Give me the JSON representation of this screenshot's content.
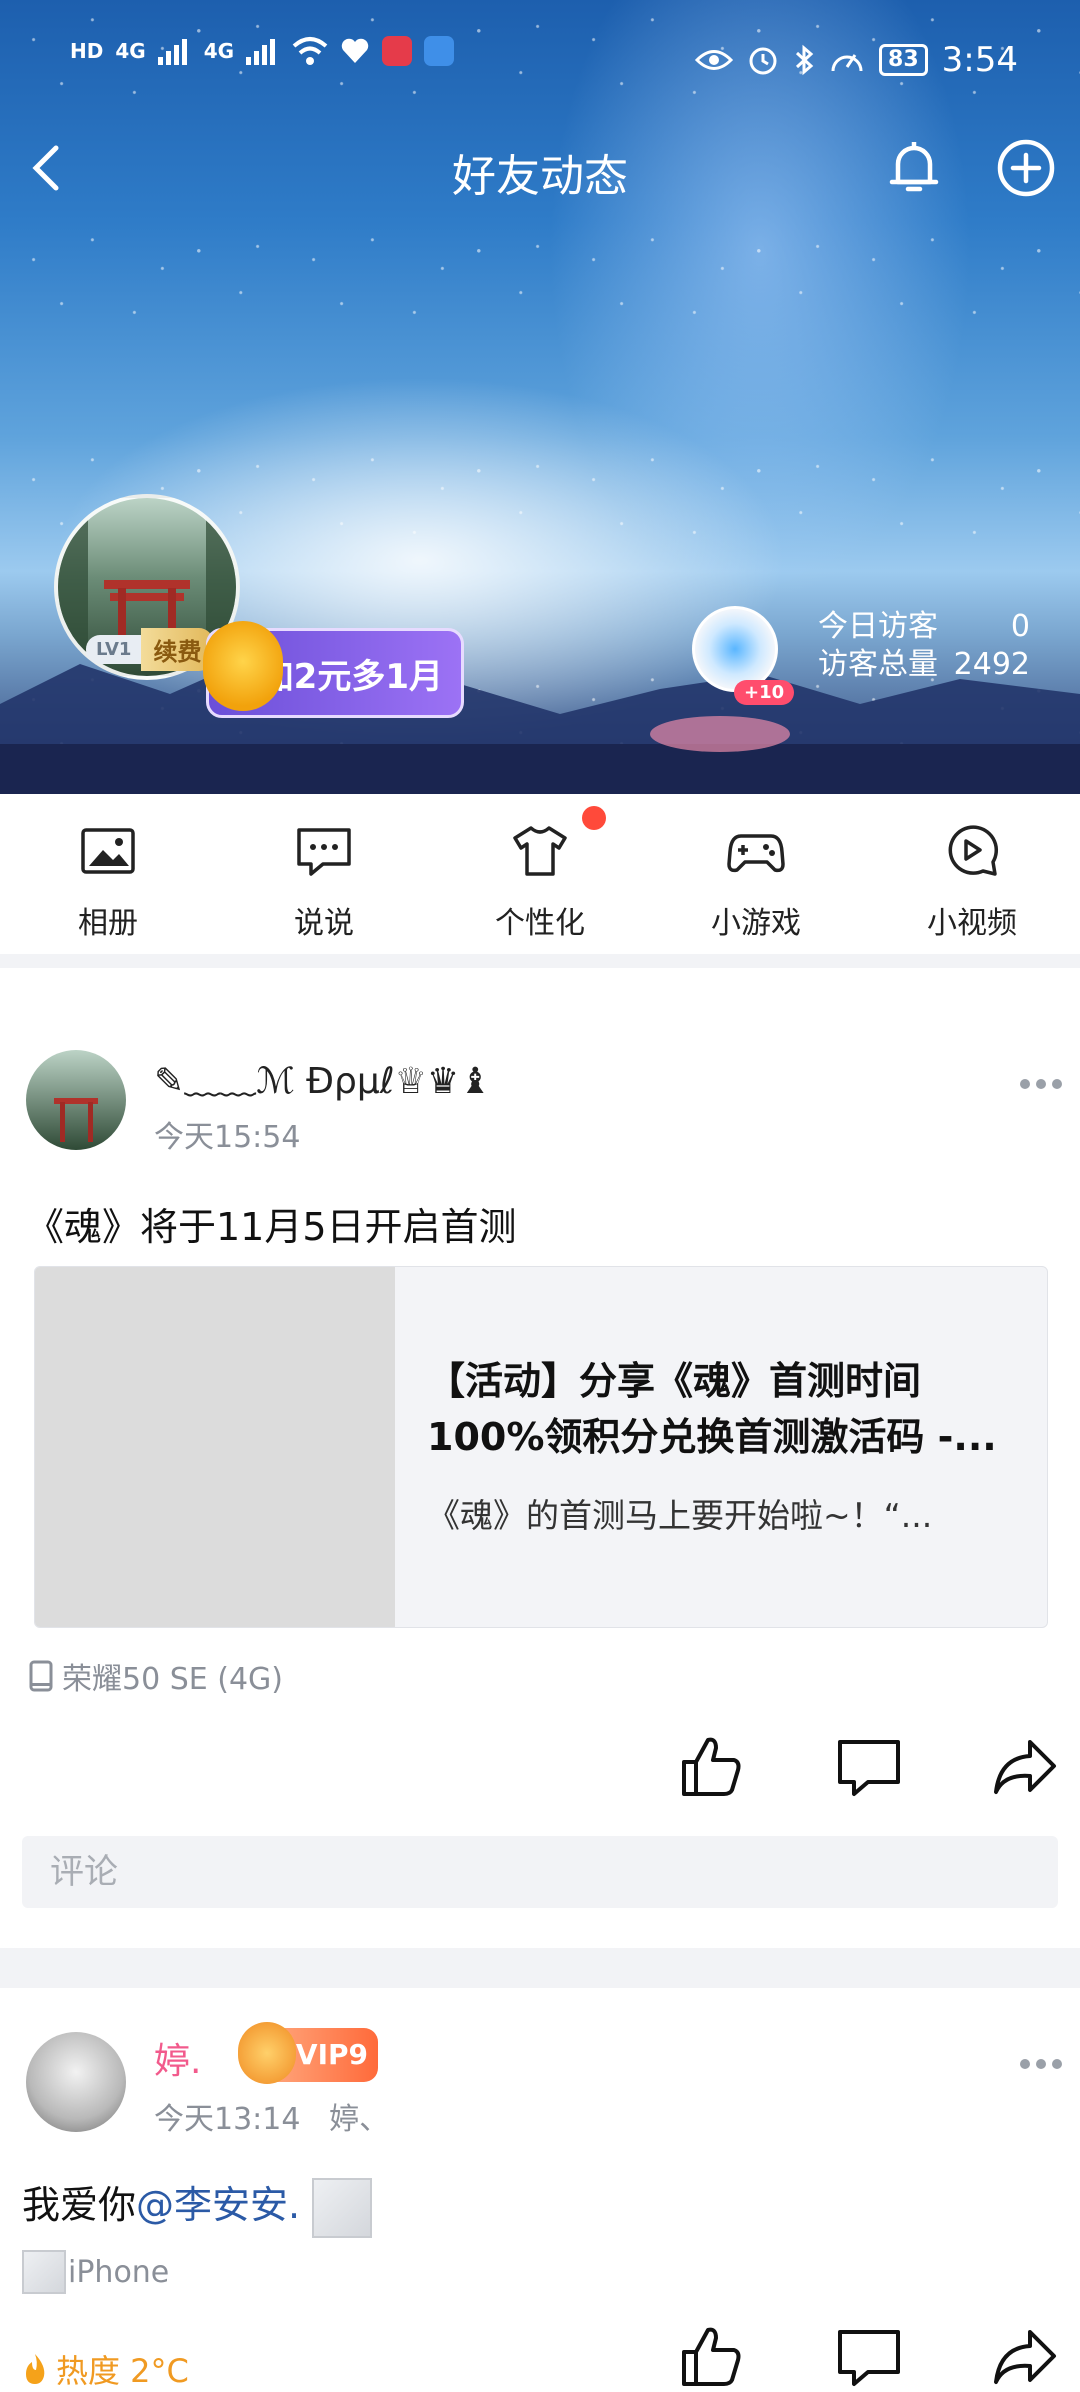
{
  "status_bar": {
    "left_labels": [
      "HD",
      "4G",
      "4G"
    ],
    "time": "3:54",
    "battery": "83",
    "icons": [
      "signal-icon",
      "wifi-icon",
      "health-icon",
      "book-app-icon",
      "browser-app-icon",
      "eye-icon",
      "alarm-icon",
      "bluetooth-icon",
      "speed-icon"
    ]
  },
  "header": {
    "title": "好友动态",
    "back_icon": "chevron-left-icon",
    "bell_icon": "bell-icon",
    "add_icon": "plus-circle-icon"
  },
  "profile": {
    "level": "LV1",
    "renew_label": "续费",
    "promo_label": "加2元多1月",
    "visitor_badge": "+10",
    "visitors_today_label": "今日访客",
    "visitors_today_value": "0",
    "visitors_total_label": "访客总量",
    "visitors_total_value": "2492"
  },
  "nav": {
    "items": [
      {
        "label": "相册",
        "icon": "photo-album-icon"
      },
      {
        "label": "说说",
        "icon": "chat-bubble-icon"
      },
      {
        "label": "个性化",
        "icon": "tshirt-icon"
      },
      {
        "label": "小游戏",
        "icon": "gamepad-icon"
      },
      {
        "label": "小视频",
        "icon": "video-play-icon"
      }
    ]
  },
  "posts": [
    {
      "author": "✎﹏﹏ℳ Ɖρμℓ♕♛♝",
      "time": "今天15:54",
      "text": "《魂》将于11月5日开启首测",
      "card": {
        "title_line1": "【活动】分享《魂》首测时间",
        "title_line2": "100%领积分兑换首测激活码 -...",
        "desc": "《魂》的首测马上要开始啦~！“..."
      },
      "device": "荣耀50 SE (4G)",
      "comment_placeholder": "评论"
    },
    {
      "author": "婷.",
      "vip_label": "VIP9",
      "time": "今天13:14",
      "sub": "婷、",
      "text_prefix": "我爱你",
      "mention": "@李安安.",
      "device": "iPhone",
      "heat": "热度 2°C"
    }
  ]
}
